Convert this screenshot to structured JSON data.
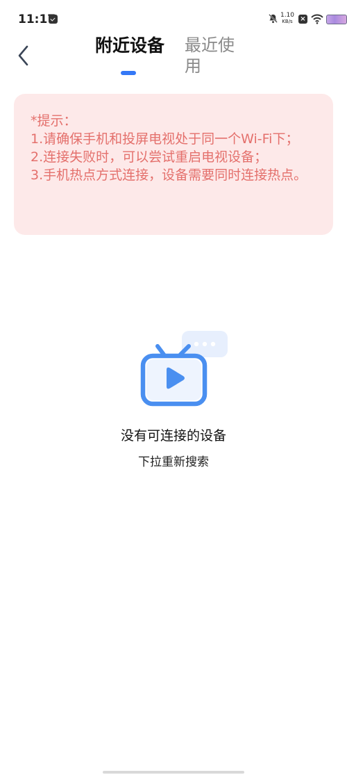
{
  "status_bar": {
    "time": "11:17",
    "net_speed_value": "1.10",
    "net_speed_unit": "KB/s",
    "icons": [
      "message-icon",
      "bell-off-icon",
      "x-app-icon",
      "wifi-icon",
      "battery-icon"
    ]
  },
  "header": {
    "back_icon": "chevron-left-icon",
    "tabs": [
      {
        "label": "附近设备",
        "active": true
      },
      {
        "label": "最近使用",
        "active": false
      }
    ],
    "accent_color": "#3478f6"
  },
  "tips": {
    "title": "*提示：",
    "items": [
      "1.请确保手机和投屏电视处于同一个Wi-Fi下；",
      "2.连接失败时，可以尝试重启电视设备；",
      "3.手机热点方式连接，设备需要同时连接热点。"
    ],
    "text_color": "#e4706c",
    "background_color": "#fde9e9"
  },
  "empty_state": {
    "icon": "tv-play-icon",
    "title": "没有可连接的设备",
    "hint": "下拉重新搜索"
  }
}
